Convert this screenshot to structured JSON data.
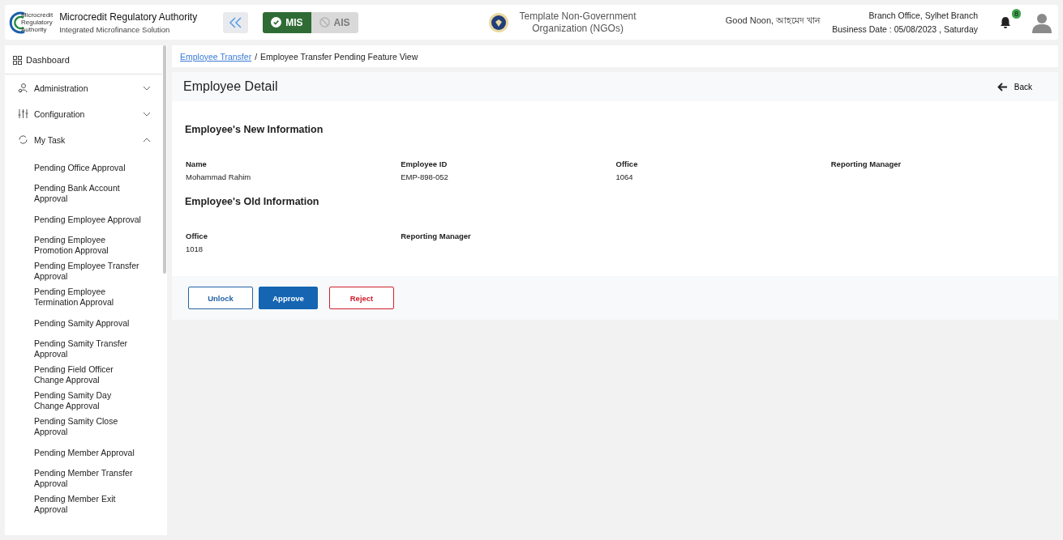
{
  "header": {
    "logo_text": [
      "Microcredit",
      "Regulatory",
      "Authority"
    ],
    "app_title": "Microcredit Regulatory Authority",
    "app_subtitle": "Integrated Microfinance Solution",
    "modules": [
      {
        "label": "MIS",
        "selected": true
      },
      {
        "label": "AIS",
        "selected": false
      }
    ],
    "org_name": "Template Non-Government Organization (NGOs)",
    "greeting": "Good Noon, আহমেদ খান",
    "branch": "Branch Office, Sylhet Branch",
    "business_date": "Business Date : 05/08/2023 , Saturday",
    "notification_count": "8"
  },
  "sidebar": {
    "dashboard": "Dashboard",
    "menus": [
      {
        "label": "Administration",
        "kind": "admin",
        "expanded": false
      },
      {
        "label": "Configuration",
        "kind": "config",
        "expanded": false
      },
      {
        "label": "My Task",
        "kind": "task",
        "expanded": true,
        "children": [
          "Pending Office Approval",
          "Pending Bank Account Approval",
          "Pending Employee Approval",
          "Pending Employee Promotion Approval",
          "Pending Employee Transfer Approval",
          "Pending Employee Termination Approval",
          "Pending Samity Approval",
          "Pending Samity Transfer Approval",
          "Pending Field Officer Change Approval",
          "Pending Samity Day Change Approval",
          "Pending Samity Close Approval",
          "Pending Member Approval",
          "Pending Member Transfer Approval",
          "Pending Member Exit Approval"
        ]
      }
    ]
  },
  "breadcrumb": {
    "link": "Employee Transfer",
    "separator": "/",
    "current": "Employee Transfer Pending Feature View"
  },
  "detail": {
    "title": "Employee Detail",
    "back": "Back",
    "sections": [
      {
        "title": "Employee's New Information",
        "fields": [
          {
            "label": "Name",
            "value": "Mohammad Rahim"
          },
          {
            "label": "Employee ID",
            "value": "EMP-898-052"
          },
          {
            "label": "Office",
            "value": "1064"
          },
          {
            "label": "Reporting Manager"
          }
        ]
      },
      {
        "title": "Employee's Old Information",
        "fields": [
          {
            "label": "Office",
            "value": "1018"
          },
          {
            "label": "Reporting Manager"
          }
        ]
      }
    ],
    "buttons": [
      {
        "label": "Unlock",
        "kind": "outline"
      },
      {
        "label": "Approve",
        "kind": "primary"
      },
      {
        "label": "Reject",
        "kind": "danger"
      }
    ]
  }
}
